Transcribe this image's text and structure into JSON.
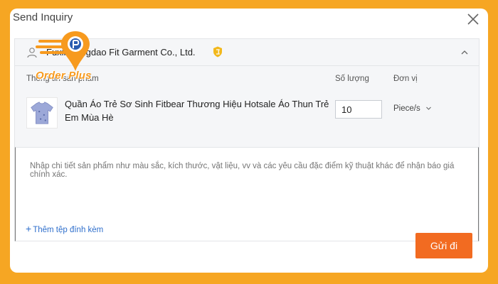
{
  "dialog": {
    "title": "Send Inquiry"
  },
  "supplier": {
    "name": "Fuxin Qingdao Fit Garment Co., Ltd.",
    "badge_icon": "gold-shield-icon"
  },
  "columns": {
    "product": "Thông tin sản phẩm",
    "quantity": "Số lượng",
    "unit": "Đơn vị"
  },
  "product": {
    "title": "Quần Áo Trẻ Sơ Sinh Fitbear Thương Hiệu Hotsale Áo Thun Trẻ Em Mùa Hè",
    "quantity": "10",
    "unit": "Piece/s"
  },
  "details": {
    "placeholder": "Nhập chi tiết sản phẩm như màu sắc, kích thước, vật liệu, vv và các yêu cầu đặc điểm kỹ thuật khác để nhận báo giá chính xác."
  },
  "attachment": {
    "label": "Thêm tệp đính kèm"
  },
  "actions": {
    "send_label": "Gửi đi"
  },
  "watermark": {
    "text": "Order Plus"
  },
  "colors": {
    "accent": "#f26b21",
    "border": "#f6a623",
    "link": "#2f6fcc"
  }
}
